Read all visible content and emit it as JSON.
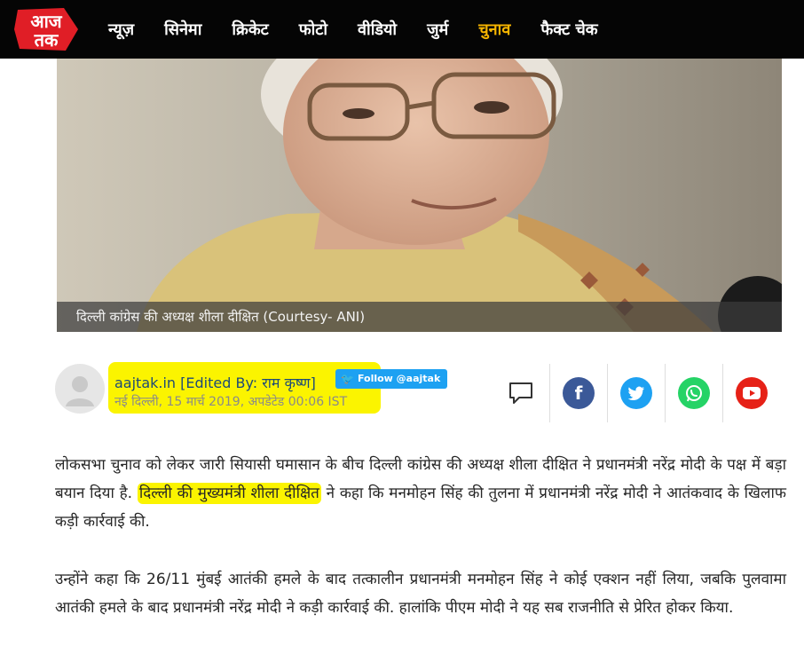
{
  "logo": {
    "text": "आज तक"
  },
  "nav": {
    "items": [
      {
        "label": "न्यूज़",
        "active": false
      },
      {
        "label": "सिनेमा",
        "active": false
      },
      {
        "label": "क्रिकेट",
        "active": false
      },
      {
        "label": "फोटो",
        "active": false
      },
      {
        "label": "वीडियो",
        "active": false
      },
      {
        "label": "जुर्म",
        "active": false
      },
      {
        "label": "चुनाव",
        "active": true
      },
      {
        "label": "फैक्ट चेक",
        "active": false
      }
    ]
  },
  "hero": {
    "caption": "दिल्ली कांग्रेस की अध्यक्ष शीला दीक्षित (Courtesy- ANI)"
  },
  "byline": {
    "author": "aajtak.in [Edited By: राम कृष्ण]",
    "follow_label": "Follow @aajtak",
    "dateline": "नई दिल्ली, 15 मार्च 2019, अपडेटेड 00:06 IST"
  },
  "share": [
    {
      "icon": "comment-icon"
    },
    {
      "icon": "facebook-icon",
      "color": "#3b5998"
    },
    {
      "icon": "twitter-icon",
      "color": "#1da1f2"
    },
    {
      "icon": "whatsapp-icon",
      "color": "#25d366"
    },
    {
      "icon": "youtube-icon",
      "color": "#e62117"
    }
  ],
  "article": {
    "p1_a": "लोकसभा चुनाव को लेकर जारी सियासी घमासान के बीच दिल्ली कांग्रेस की अध्यक्ष शीला दीक्षित ने प्रधानमंत्री नरेंद्र मोदी के पक्ष में बड़ा बयान दिया है.",
    "p1_highlight": "दिल्ली की मुख्यमंत्री शीला दीक्षित",
    "p1_b": "ने कहा कि मनमोहन सिंह की तुलना में प्रधानमंत्री नरेंद्र मोदी ने आतंकवाद के खिलाफ कड़ी कार्रवाई की.",
    "p2": "उन्होंने कहा कि 26/11 मुंबई आतंकी हमले के बाद तत्कालीन प्रधानमंत्री मनमोहन सिंह ने कोई एक्शन नहीं लिया, जबकि पुलवामा आतंकी हमले के बाद प्रधानमंत्री नरेंद्र मोदी ने कड़ी कार्रवाई की. हालांकि पीएम मोदी ने यह सब राजनीति से प्रेरित होकर किया."
  },
  "colors": {
    "nav_bg": "#050505",
    "nav_active": "#f7b500",
    "highlight": "#fbf400",
    "brand_red": "#e01e26"
  }
}
